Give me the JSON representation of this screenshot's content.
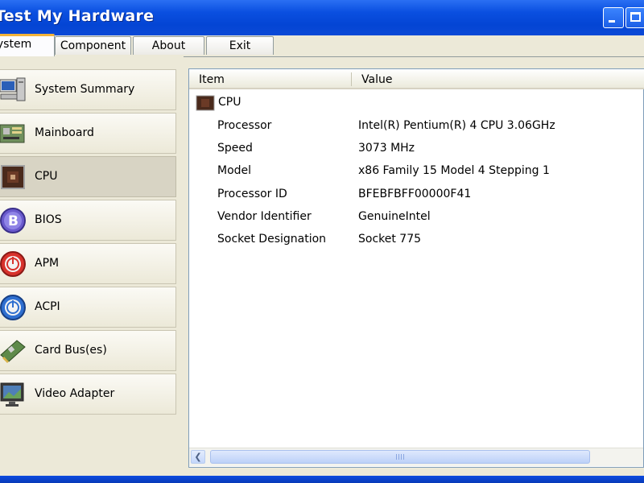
{
  "window": {
    "title": "Test My Hardware"
  },
  "tabs": [
    {
      "label": "System",
      "active": true
    },
    {
      "label": "Component"
    },
    {
      "label": "About"
    },
    {
      "label": "Exit"
    }
  ],
  "sidebar": {
    "items": [
      {
        "label": "System Summary",
        "icon": "computer-icon"
      },
      {
        "label": "Mainboard",
        "icon": "mainboard-icon"
      },
      {
        "label": "CPU",
        "icon": "cpu-chip-icon",
        "active": true
      },
      {
        "label": "BIOS",
        "icon": "bios-b-icon"
      },
      {
        "label": "APM",
        "icon": "power-red-icon"
      },
      {
        "label": "ACPI",
        "icon": "power-blue-icon"
      },
      {
        "label": "Card Bus(es)",
        "icon": "card-bus-icon"
      },
      {
        "label": "Video Adapter",
        "icon": "monitor-icon"
      }
    ]
  },
  "details": {
    "columns": {
      "item": "Item",
      "value": "Value"
    },
    "root": {
      "label": "CPU",
      "icon": "cpu-chip-icon"
    },
    "rows": [
      {
        "key": "Processor",
        "value": "Intel(R) Pentium(R) 4 CPU 3.06GHz"
      },
      {
        "key": "Speed",
        "value": "3073 MHz"
      },
      {
        "key": "Model",
        "value": "x86 Family 15 Model 4 Stepping 1"
      },
      {
        "key": "Processor ID",
        "value": "BFEBFBFF00000F41"
      },
      {
        "key": "Vendor Identifier",
        "value": "GenuineIntel"
      },
      {
        "key": "Socket Designation",
        "value": "Socket 775"
      }
    ]
  },
  "colors": {
    "titlebar": "#0445d4",
    "tab_accent": "#f3b33a",
    "active_item": "#d8d4c4"
  }
}
